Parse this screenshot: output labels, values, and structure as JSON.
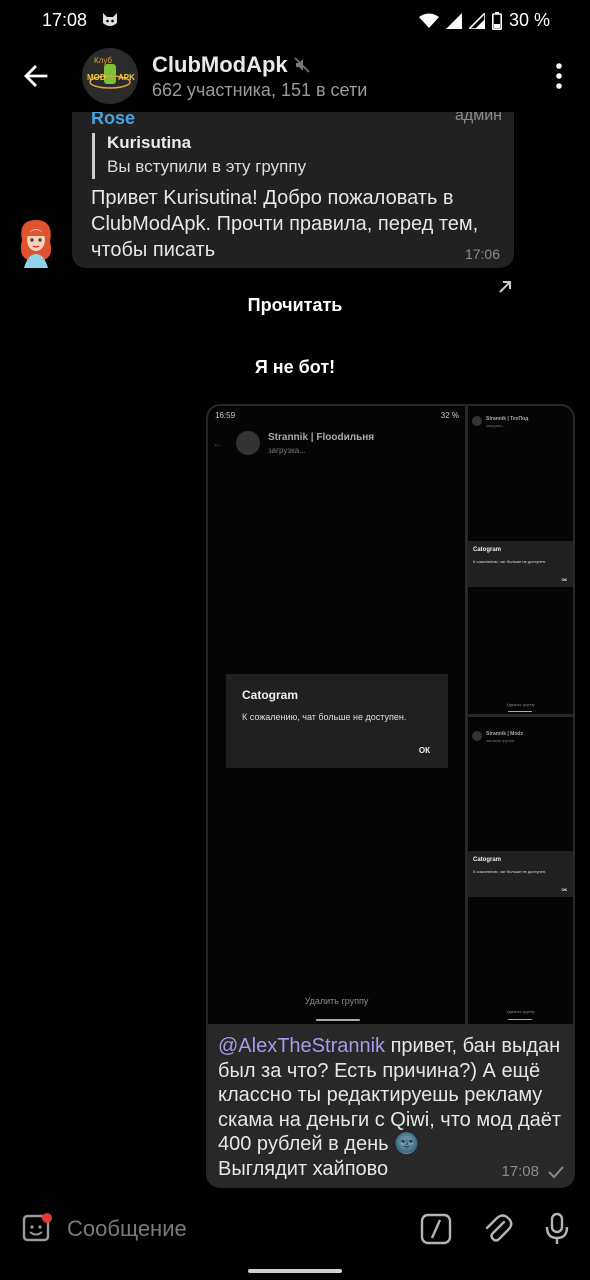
{
  "status_bar": {
    "time": "17:08",
    "battery": "30 %",
    "icons": [
      "cat-icon",
      "wifi-icon",
      "signal-icon",
      "signal-icon",
      "battery-icon"
    ]
  },
  "header": {
    "title": "ClubModApk",
    "subtitle": "662 участника, 151 в сети",
    "avatar_text": {
      "line1": "Клуб",
      "line2": "MOD",
      "line3": "APK"
    },
    "muted_icon": "muted-speaker-icon"
  },
  "message1": {
    "sender": "Rose",
    "badge": "админ",
    "reply": {
      "name": "Kurisutina",
      "text": "Вы вступили в эту группу"
    },
    "text": "Привет Kurisutina! Добро пожаловать в ClubModApk. Прочти правила, перед тем, чтобы писать",
    "time": "17:06"
  },
  "inline_buttons": {
    "read": "Прочитать",
    "not_bot": "Я не бот!"
  },
  "message2": {
    "screenshots": {
      "main": {
        "status_time": "16:59",
        "battery": "32 %",
        "chat_title": "Strannik | Floodильня",
        "chat_sub": "загрузка...",
        "dialog_title": "Catogram",
        "dialog_text": "К сожалению, чат больше не доступен.",
        "dialog_ok": "ОК",
        "footer": "Удалить группу"
      },
      "top": {
        "chat_title": "Strannik | ТехПод",
        "chat_sub": "загрузка...",
        "dialog_title": "Catogram",
        "dialog_text": "К сожалению, чат больше не доступен.",
        "dialog_ok": "ОК",
        "footer": "Удалить группу"
      },
      "bottom": {
        "chat_title": "Strannik | Modz",
        "chat_sub": "частная группа",
        "dialog_title": "Catogram",
        "dialog_text": "К сожалению, чат больше не доступен.",
        "dialog_ok": "ОК",
        "footer": "Удалить группу"
      }
    },
    "mention": "@AlexTheStrannik",
    "text_after_mention": " привет, бан выдан был за что? Есть причина?) А ещё классно ты редактируешь рекламу скама на деньги с Qiwi, что мод даёт 400 рублей в день",
    "text_last": "Выглядит хайпово",
    "emoji": "🌚",
    "time": "17:08"
  },
  "input": {
    "placeholder": "Сообщение"
  },
  "colors": {
    "background": "#000000",
    "bubble": "#212121",
    "sender": "#4aa3df",
    "mention": "#a79bea",
    "meta": "#8a8a8a"
  }
}
